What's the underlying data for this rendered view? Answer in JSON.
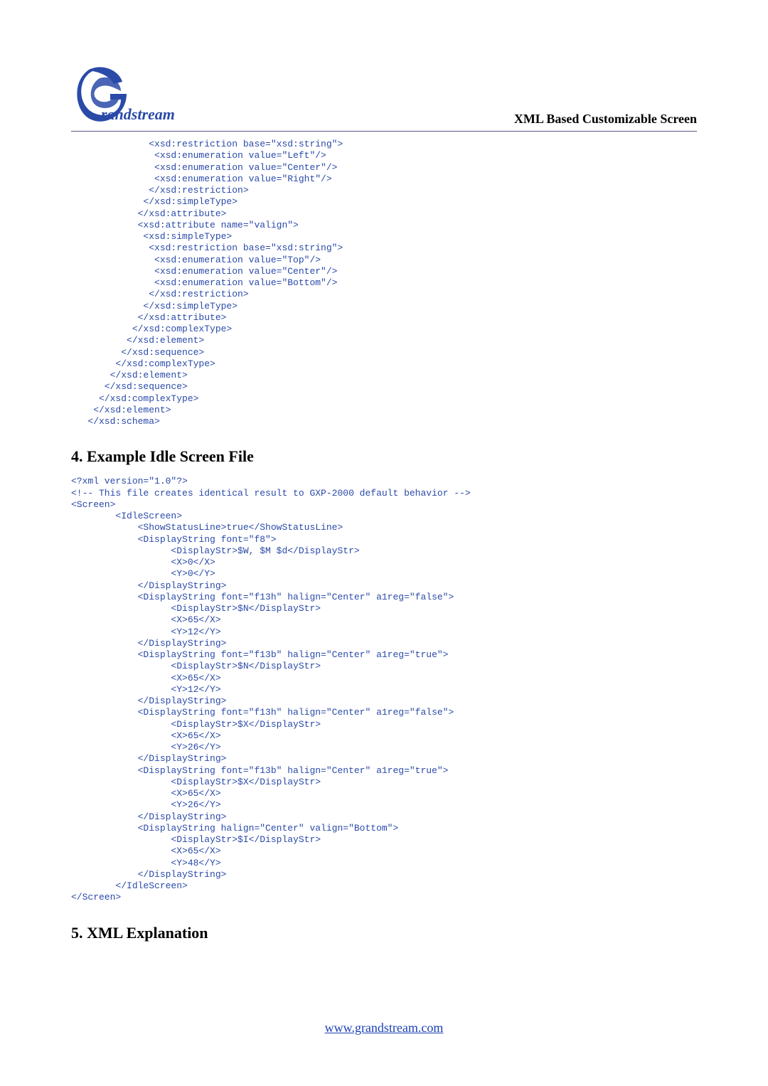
{
  "header": {
    "title": "XML Based Customizable Screen"
  },
  "sections": {
    "s4": "4.  Example Idle Screen File",
    "s5": "5.  XML Explanation"
  },
  "footer": {
    "url": "www.grandstream.com"
  },
  "code1": "              <xsd:restriction base=\"xsd:string\">\n               <xsd:enumeration value=\"Left\"/>\n               <xsd:enumeration value=\"Center\"/>\n               <xsd:enumeration value=\"Right\"/>\n              </xsd:restriction>\n             </xsd:simpleType>\n            </xsd:attribute>\n            <xsd:attribute name=\"valign\">\n             <xsd:simpleType>\n              <xsd:restriction base=\"xsd:string\">\n               <xsd:enumeration value=\"Top\"/>\n               <xsd:enumeration value=\"Center\"/>\n               <xsd:enumeration value=\"Bottom\"/>\n              </xsd:restriction>\n             </xsd:simpleType>\n            </xsd:attribute>\n           </xsd:complexType>\n          </xsd:element>\n         </xsd:sequence>\n        </xsd:complexType>\n       </xsd:element>\n      </xsd:sequence>\n     </xsd:complexType>\n    </xsd:element>\n   </xsd:schema>",
  "code2": "<?xml version=\"1.0\"?>\n<!-- This file creates identical result to GXP-2000 default behavior -->\n<Screen>\n        <IdleScreen>\n            <ShowStatusLine>true</ShowStatusLine>\n            <DisplayString font=\"f8\">\n                  <DisplayStr>$W, $M $d</DisplayStr>\n                  <X>0</X>\n                  <Y>0</Y>\n            </DisplayString>\n            <DisplayString font=\"f13h\" halign=\"Center\" a1reg=\"false\">\n                  <DisplayStr>$N</DisplayStr>\n                  <X>65</X>\n                  <Y>12</Y>\n            </DisplayString>\n            <DisplayString font=\"f13b\" halign=\"Center\" a1reg=\"true\">\n                  <DisplayStr>$N</DisplayStr>\n                  <X>65</X>\n                  <Y>12</Y>\n            </DisplayString>\n            <DisplayString font=\"f13h\" halign=\"Center\" a1reg=\"false\">\n                  <DisplayStr>$X</DisplayStr>\n                  <X>65</X>\n                  <Y>26</Y>\n            </DisplayString>\n            <DisplayString font=\"f13b\" halign=\"Center\" a1reg=\"true\">\n                  <DisplayStr>$X</DisplayStr>\n                  <X>65</X>\n                  <Y>26</Y>\n            </DisplayString>\n            <DisplayString halign=\"Center\" valign=\"Bottom\">\n                  <DisplayStr>$I</DisplayStr>\n                  <X>65</X>\n                  <Y>48</Y>\n            </DisplayString>\n        </IdleScreen>\n</Screen>"
}
